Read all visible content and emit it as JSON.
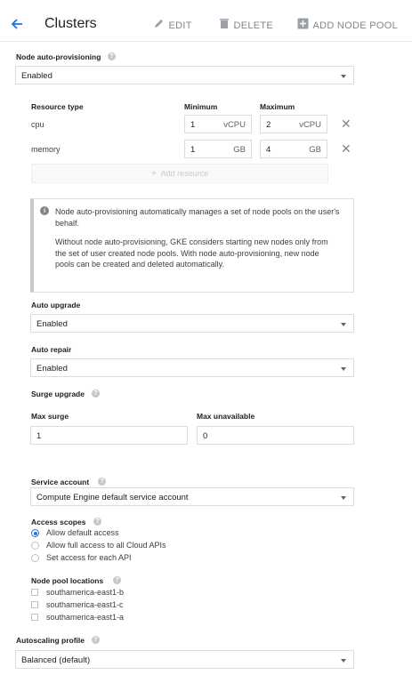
{
  "header": {
    "title": "Clusters",
    "edit": "EDIT",
    "delete": "DELETE",
    "add_pool": "ADD NODE POOL"
  },
  "nap": {
    "label": "Node auto-provisioning",
    "value": "Enabled"
  },
  "resources": {
    "col_type": "Resource type",
    "col_min": "Minimum",
    "col_max": "Maximum",
    "rows": [
      {
        "type": "cpu",
        "min": "1",
        "min_unit": "vCPU",
        "max": "2",
        "max_unit": "vCPU"
      },
      {
        "type": "memory",
        "min": "1",
        "min_unit": "GB",
        "max": "4",
        "max_unit": "GB"
      }
    ],
    "add": "Add resource"
  },
  "info": {
    "p1": "Node auto-provisioning automatically manages a set of node pools on the user's behalf.",
    "p2": "Without node auto-provisioning, GKE considers starting new nodes only from the set of user created node pools. With node auto-provisioning, new node pools can be created and deleted automatically."
  },
  "auto_upgrade": {
    "label": "Auto upgrade",
    "value": "Enabled"
  },
  "auto_repair": {
    "label": "Auto repair",
    "value": "Enabled"
  },
  "surge": {
    "label": "Surge upgrade",
    "max_surge_label": "Max surge",
    "max_surge": "1",
    "max_unavail_label": "Max unavailable",
    "max_unavail": "0"
  },
  "service_account": {
    "label": "Service account",
    "value": "Compute Engine default service account"
  },
  "scopes": {
    "label": "Access scopes",
    "options": [
      "Allow default access",
      "Allow full access to all Cloud APIs",
      "Set access for each API"
    ],
    "selected": 0
  },
  "locations": {
    "label": "Node pool locations",
    "items": [
      "southamerica-east1-b",
      "southamerica-east1-c",
      "southamerica-east1-a"
    ]
  },
  "autoscaling": {
    "label": "Autoscaling profile",
    "value": "Balanced (default)"
  }
}
